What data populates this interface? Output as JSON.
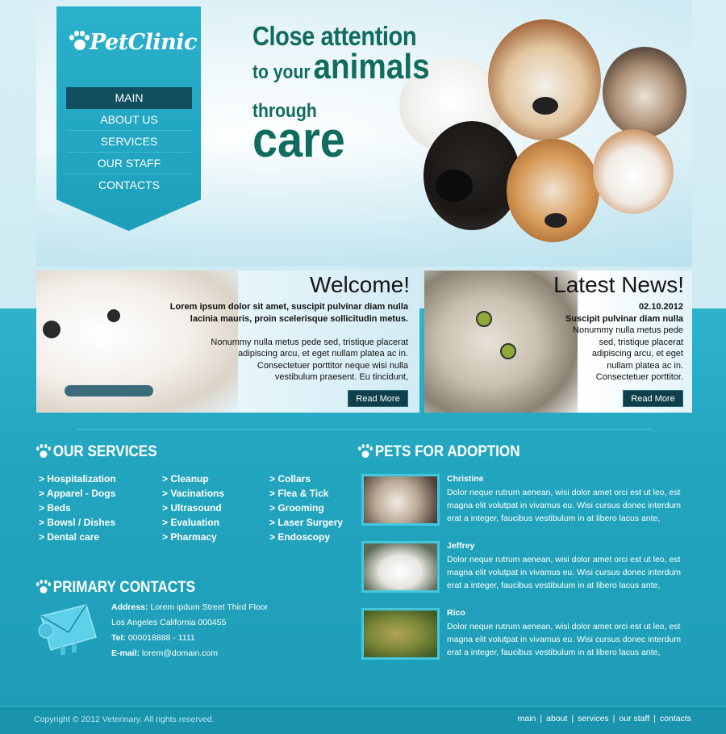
{
  "brand": {
    "name": "PetClinic"
  },
  "nav": {
    "items": [
      {
        "label": "MAIN"
      },
      {
        "label": "ABOUT US"
      },
      {
        "label": "SERVICES"
      },
      {
        "label": "OUR STAFF"
      },
      {
        "label": "CONTACTS"
      }
    ]
  },
  "hero": {
    "line1": "Close attention",
    "line2_small": "to your",
    "line2_big": "animals",
    "line3": "through",
    "line4": "care"
  },
  "welcome": {
    "title": "Welcome!",
    "bold_text_1": "Lorem ipsum dolor sit amet, suscipit pulvinar diam nulla",
    "bold_text_2": "lacinia mauris, proin scelerisque sollicitudin metus.",
    "text_1": "Nonummy nulla metus pede sed, tristique placerat",
    "text_2": "adipiscing arcu, et eget nullam platea ac in.",
    "text_3": "Consectetuer porttitor neque wisi nulla",
    "text_4": "vestibulum praesent. Eu tincidunt,",
    "button": "Read More"
  },
  "news": {
    "title": "Latest News!",
    "date": "02.10.2012",
    "bold_text": "Suscipit pulvinar diam nulla",
    "text_1": "Nonummy nulla metus pede",
    "text_2": "sed, tristique placerat",
    "text_3": "adipiscing arcu, et eget",
    "text_4": "nullam platea ac in.",
    "text_5": "Consectetuer porttitor.",
    "button": "Read More"
  },
  "services": {
    "title": "OUR SERVICES",
    "col1": [
      "> Hospitalization",
      "> Apparel - Dogs",
      "> Beds",
      "> Bowsl / Dishes",
      "> Dental care"
    ],
    "col2": [
      "> Cleanup",
      "> Vacinations",
      "> Ultrasound",
      "> Evaluation",
      "> Pharmacy"
    ],
    "col3": [
      "> Collars",
      "> Flea & Tick",
      "> Grooming",
      "> Laser Surgery",
      "> Endoscopy"
    ]
  },
  "contacts": {
    "title": "PRIMARY CONTACTS",
    "address_label": "Address:",
    "address_1": "Lorem ipdum Street Third Floor",
    "address_2": "Los Angeles California 000455",
    "tel_label": "Tel:",
    "tel": "000018888 - 1111",
    "email_label": "E-mail:",
    "email": "lorem@domain.com"
  },
  "adoption": {
    "title": "PETS FOR ADOPTION",
    "pets": [
      {
        "name": "Christine",
        "desc": "Dolor neque rutrum aenean, wisi dolor amet orci est ut leo, est magna elit volutpat in vivamus eu. Wisi cursus donec interdum erat a integer, faucibus vestibulum in at libero lacus ante,"
      },
      {
        "name": "Jeffrey",
        "desc": "Dolor neque rutrum aenean, wisi dolor amet orci est ut leo, est magna elit volutpat in vivamus eu. Wisi cursus donec interdum erat a integer, faucibus vestibulum in at libero lacus ante,"
      },
      {
        "name": "Rico",
        "desc": "Dolor neque rutrum aenean, wisi dolor amet orci est ut leo, est magna elit volutpat in vivamus eu. Wisi cursus donec interdum erat a integer, faucibus vestibulum in at libero lacus ante,"
      }
    ]
  },
  "footer": {
    "copyright": "Copyright © 2012 Veterinary. All rights reserved.",
    "links": [
      "main",
      "about",
      "services",
      "our staff",
      "contacts"
    ],
    "separators": [
      "|",
      "|",
      "|",
      "|"
    ]
  },
  "colors": {
    "accent": "#22a6bf",
    "nav_active": "#0f4f5e",
    "headline": "#0f6c5e",
    "button": "#0f3f4a"
  }
}
